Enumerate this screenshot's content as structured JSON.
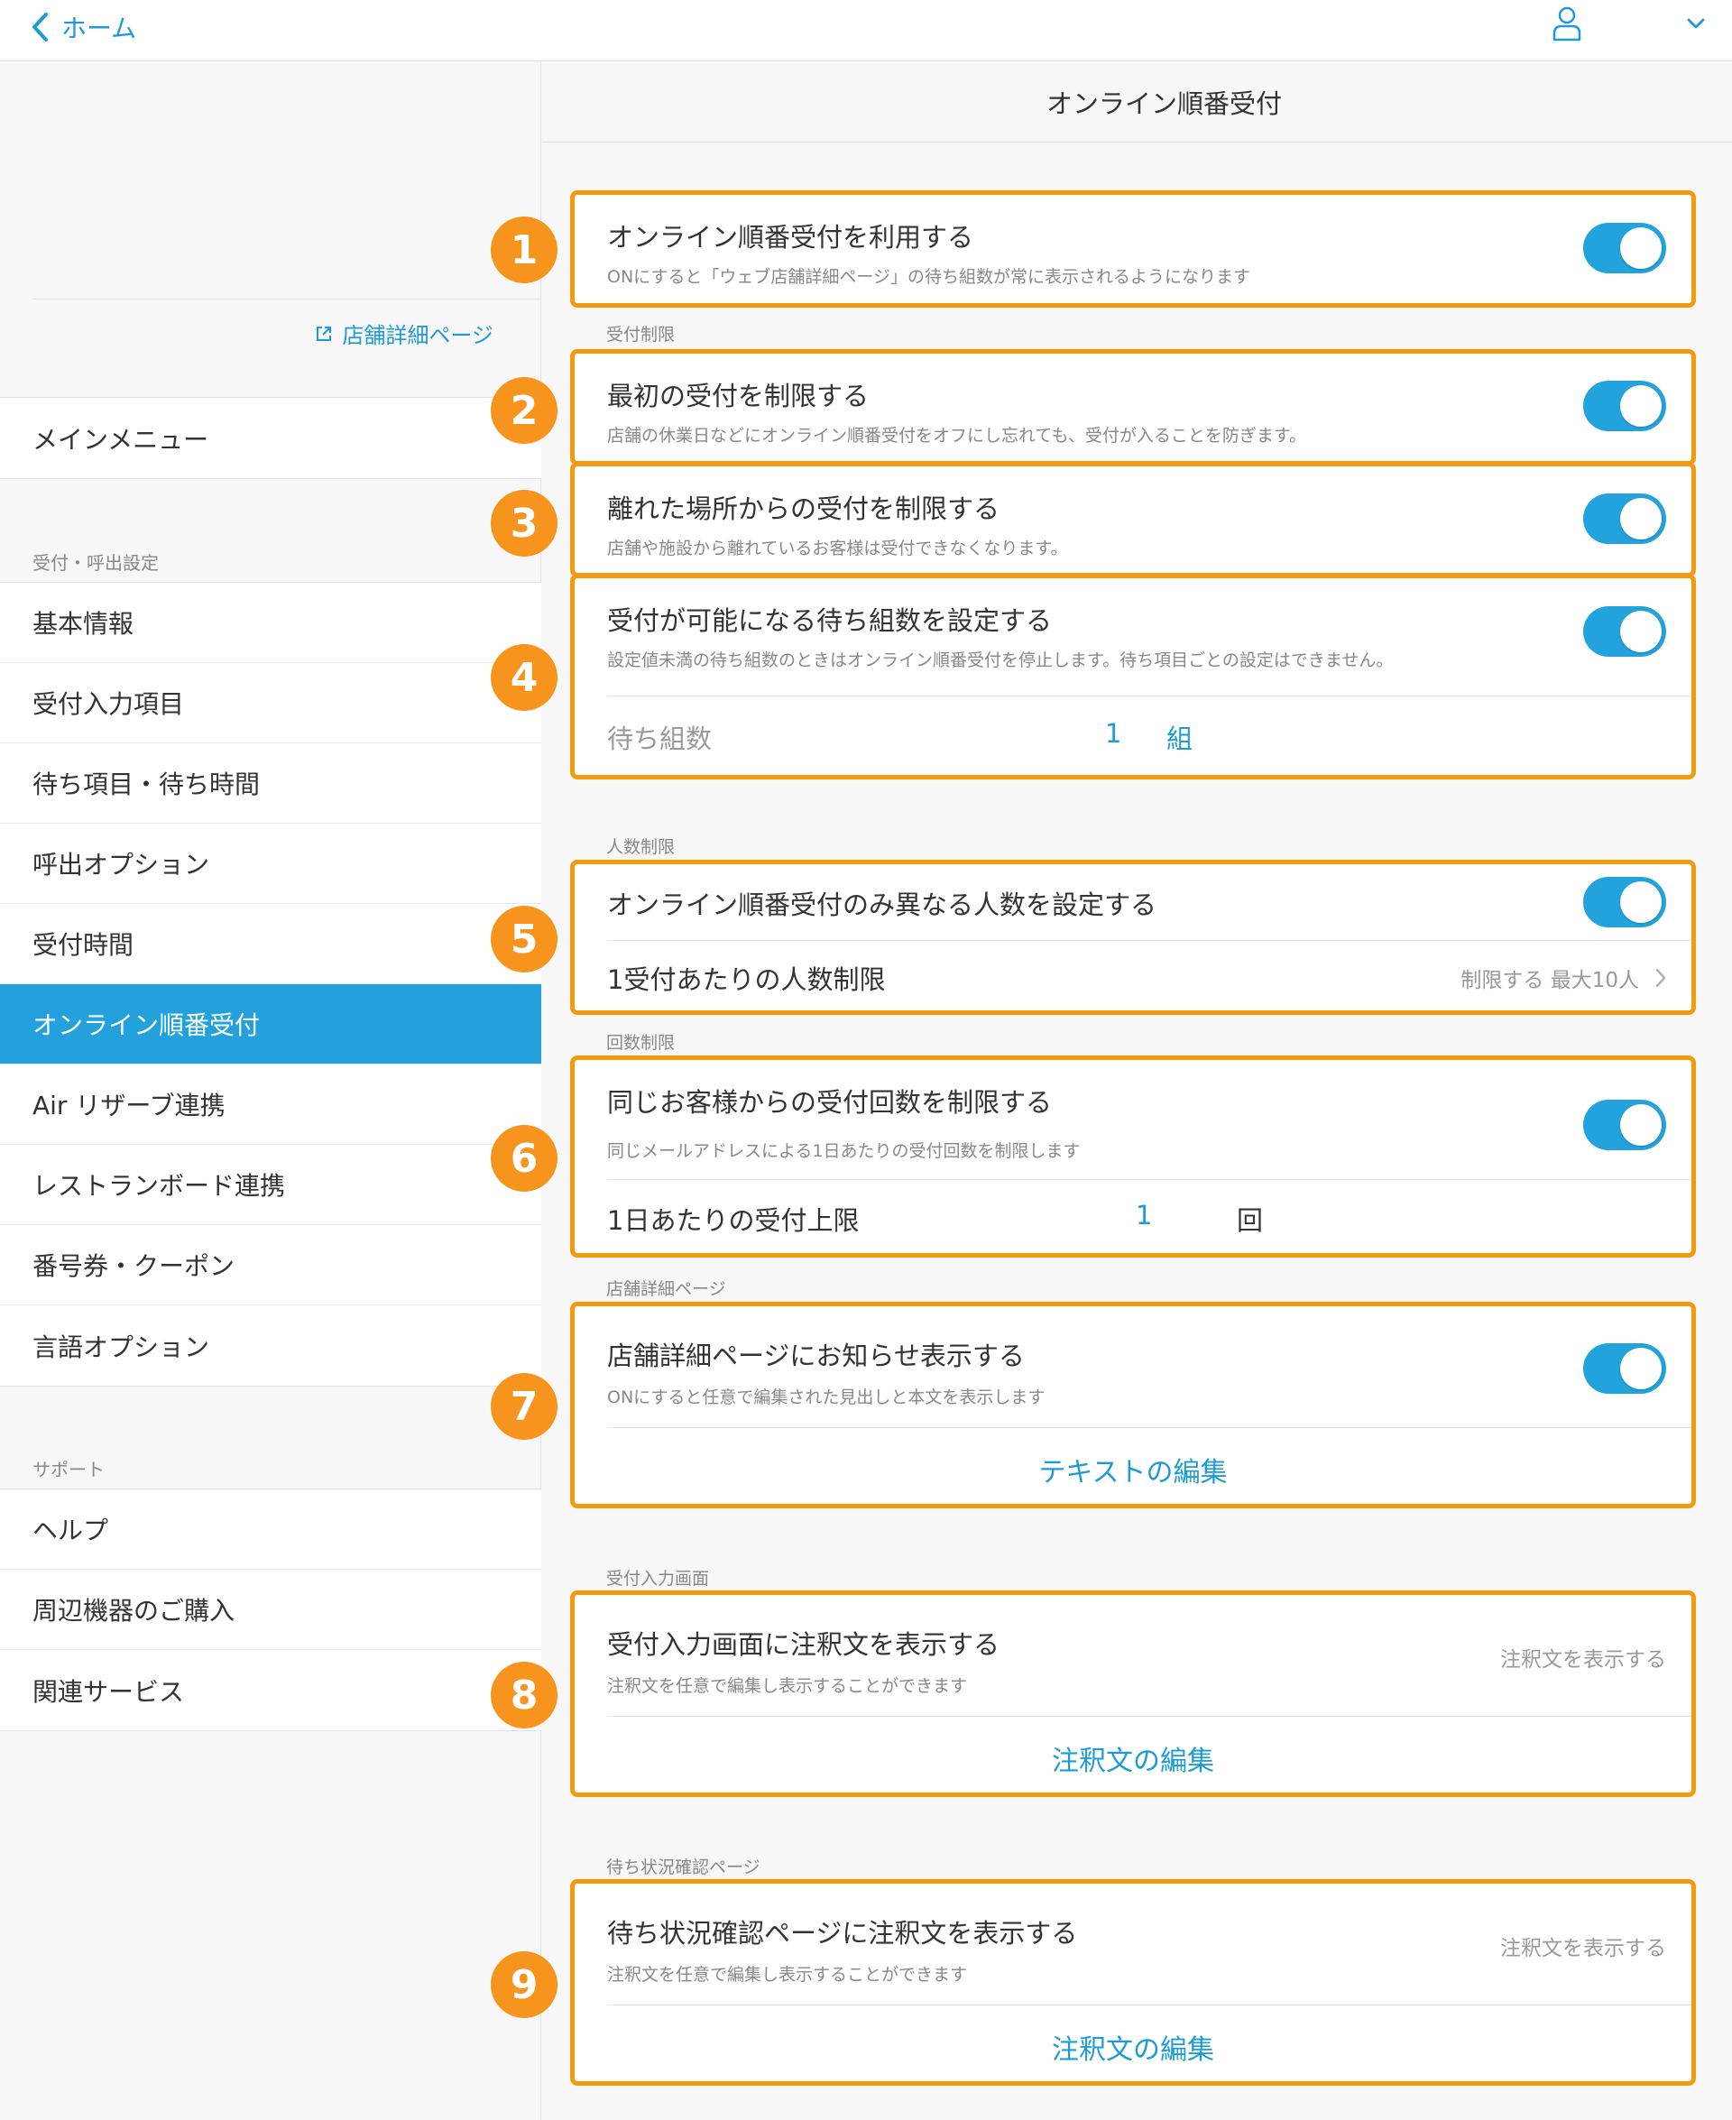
{
  "nav": {
    "back_label": "ホーム"
  },
  "sidebar": {
    "store_link": "店舗詳細ページ",
    "main_menu": "メインメニュー",
    "section_settings": "受付・呼出設定",
    "settings_items": [
      "基本情報",
      "受付入力項目",
      "待ち項目・待ち時間",
      "呼出オプション",
      "受付時間",
      "オンライン順番受付",
      "Air リザーブ連携",
      "レストランボード連携",
      "番号券・クーポン",
      "言語オプション"
    ],
    "active_item": "オンライン順番受付",
    "section_support": "サポート",
    "support_items": [
      "ヘルプ",
      "周辺機器のご購入",
      "関連サービス"
    ]
  },
  "main": {
    "title": "オンライン順番受付",
    "badges": [
      "1",
      "2",
      "3",
      "4",
      "5",
      "6",
      "7",
      "8",
      "9"
    ],
    "use_online": {
      "title": "オンライン順番受付を利用する",
      "desc": "ONにすると「ウェブ店舗詳細ページ」の待ち組数が常に表示されるようになります"
    },
    "section_reception_limit": "受付制限",
    "limit_first": {
      "title": "最初の受付を制限する",
      "desc": "店舗の休業日などにオンライン順番受付をオフにし忘れても、受付が入ることを防ぎます。"
    },
    "limit_distance": {
      "title": "離れた場所からの受付を制限する",
      "desc": "店舗や施設から離れているお客様は受付できなくなります。"
    },
    "wait_groups": {
      "title": "受付が可能になる待ち組数を設定する",
      "desc": "設定値未満の待ち組数のときはオンライン順番受付を停止します。待ち項目ごとの設定はできません。",
      "field_label": "待ち組数",
      "value": "1",
      "unit": "組"
    },
    "section_people_limit": "人数制限",
    "people": {
      "title": "オンライン順番受付のみ異なる人数を設定する",
      "row_label": "1受付あたりの人数制限",
      "row_value": "制限する 最大10人"
    },
    "section_count_limit": "回数制限",
    "count": {
      "title": "同じお客様からの受付回数を制限する",
      "desc": "同じメールアドレスによる1日あたりの受付回数を制限します",
      "row_label": "1日あたりの受付上限",
      "value": "1",
      "unit": "回"
    },
    "section_store_page": "店舗詳細ページ",
    "notice": {
      "title": "店舗詳細ページにお知らせ表示する",
      "desc": "ONにすると任意で編集された見出しと本文を表示します",
      "link": "テキストの編集"
    },
    "section_input_screen": "受付入力画面",
    "input_note": {
      "title": "受付入力画面に注釈文を表示する",
      "desc": "注釈文を任意で編集し表示することができます",
      "status": "注釈文を表示する",
      "link": "注釈文の編集"
    },
    "section_status_page": "待ち状況確認ページ",
    "status_note": {
      "title": "待ち状況確認ページに注釈文を表示する",
      "desc": "注釈文を任意で編集し表示することができます",
      "status": "注釈文を表示する",
      "link": "注釈文の編集"
    }
  }
}
